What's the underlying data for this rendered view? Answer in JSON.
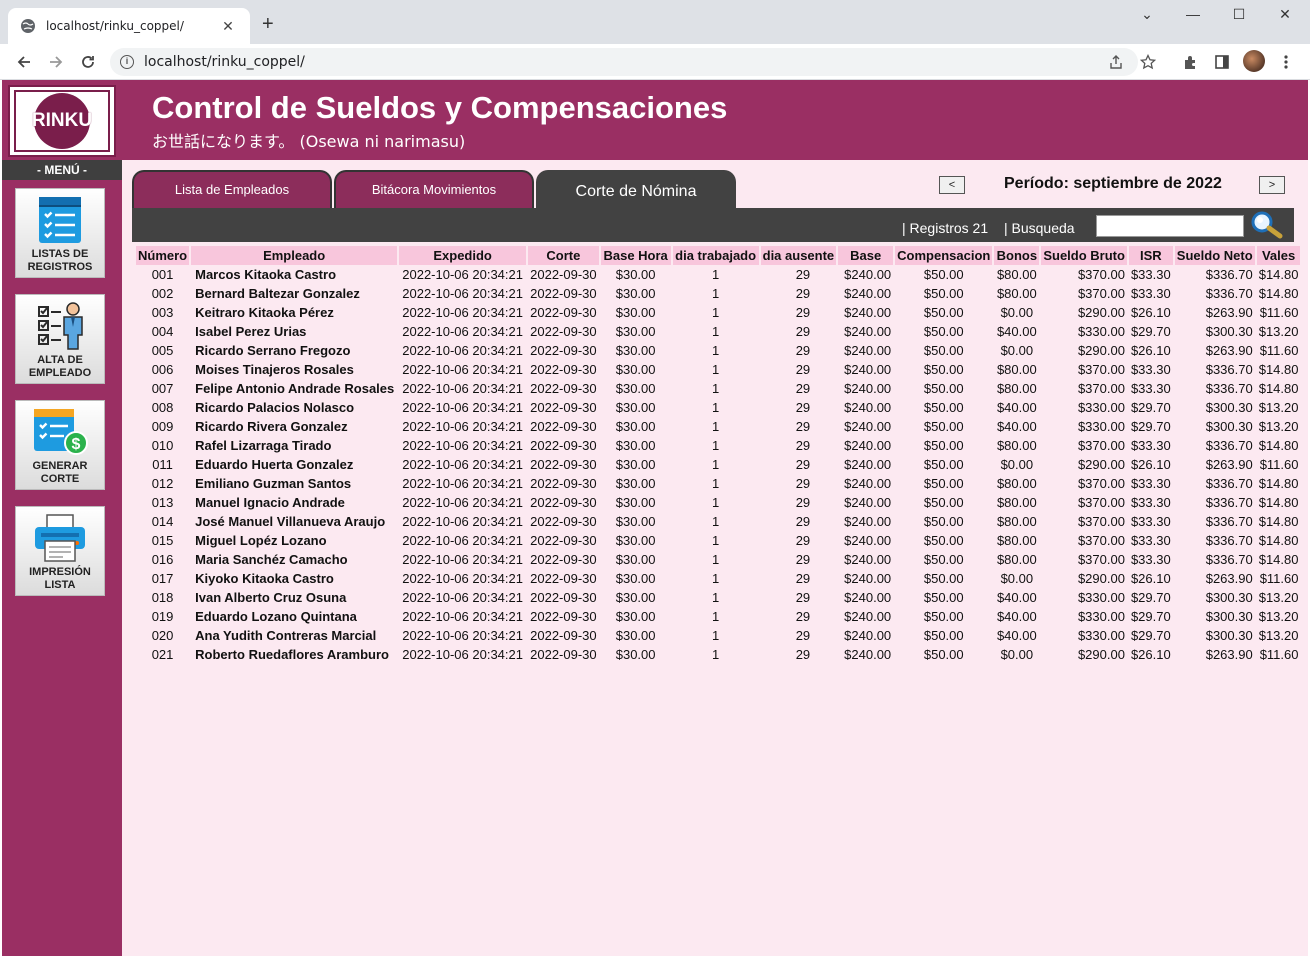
{
  "browser": {
    "tab_title": "localhost/rinku_coppel/",
    "url": "localhost/rinku_coppel/"
  },
  "app": {
    "logo_text": "RINKU",
    "title": "Control de Sueldos y Compensaciones",
    "subtitle": "お世話になります。 (Osewa ni narimasu)"
  },
  "sidebar": {
    "menu_title": "- MENÚ -",
    "items": [
      {
        "label": "LISTAS DE REGISTROS",
        "icon": "list-icon"
      },
      {
        "label": "ALTA DE EMPLEADO",
        "icon": "employee-checklist-icon"
      },
      {
        "label": "GENERAR CORTE",
        "icon": "payroll-dollar-icon"
      },
      {
        "label": "IMPRESIÓN LISTA",
        "icon": "printer-icon"
      }
    ]
  },
  "tabs": [
    {
      "label": "Lista de Empleados",
      "active": false
    },
    {
      "label": "Bitácora Movimientos",
      "active": false
    },
    {
      "label": "Corte de Nómina",
      "active": true
    }
  ],
  "period": {
    "prev": "<",
    "label": "Período: septiembre de 2022",
    "next": ">"
  },
  "filter": {
    "records": "|  Registros 21",
    "search_label": "|   Busqueda",
    "search_value": ""
  },
  "colors": {
    "brand": "#9a2f63",
    "header_cell": "#f8c6dc",
    "background": "#fce9f1",
    "bar": "#424242"
  },
  "table": {
    "headers": [
      "Número",
      "Empleado",
      "Expedido",
      "Corte",
      "Base Hora",
      "dia trabajado",
      "dia ausente",
      "Base",
      "Compensacion",
      "Bonos",
      "Sueldo Bruto",
      "ISR",
      "Sueldo Neto",
      "Vales"
    ],
    "rows": [
      [
        "001",
        "Marcos Kitaoka Castro",
        "2022-10-06 20:34:21",
        "2022-09-30",
        "$30.00",
        "1",
        "29",
        "$240.00",
        "$50.00",
        "$80.00",
        "$370.00",
        "$33.30",
        "$336.70",
        "$14.80"
      ],
      [
        "002",
        "Bernard Baltezar Gonzalez",
        "2022-10-06 20:34:21",
        "2022-09-30",
        "$30.00",
        "1",
        "29",
        "$240.00",
        "$50.00",
        "$80.00",
        "$370.00",
        "$33.30",
        "$336.70",
        "$14.80"
      ],
      [
        "003",
        "Keitraro Kitaoka Pérez",
        "2022-10-06 20:34:21",
        "2022-09-30",
        "$30.00",
        "1",
        "29",
        "$240.00",
        "$50.00",
        "$0.00",
        "$290.00",
        "$26.10",
        "$263.90",
        "$11.60"
      ],
      [
        "004",
        "Isabel Perez Urias",
        "2022-10-06 20:34:21",
        "2022-09-30",
        "$30.00",
        "1",
        "29",
        "$240.00",
        "$50.00",
        "$40.00",
        "$330.00",
        "$29.70",
        "$300.30",
        "$13.20"
      ],
      [
        "005",
        "Ricardo Serrano Fregozo",
        "2022-10-06 20:34:21",
        "2022-09-30",
        "$30.00",
        "1",
        "29",
        "$240.00",
        "$50.00",
        "$0.00",
        "$290.00",
        "$26.10",
        "$263.90",
        "$11.60"
      ],
      [
        "006",
        "Moises Tinajeros Rosales",
        "2022-10-06 20:34:21",
        "2022-09-30",
        "$30.00",
        "1",
        "29",
        "$240.00",
        "$50.00",
        "$80.00",
        "$370.00",
        "$33.30",
        "$336.70",
        "$14.80"
      ],
      [
        "007",
        "Felipe Antonio Andrade Rosales",
        "2022-10-06 20:34:21",
        "2022-09-30",
        "$30.00",
        "1",
        "29",
        "$240.00",
        "$50.00",
        "$80.00",
        "$370.00",
        "$33.30",
        "$336.70",
        "$14.80"
      ],
      [
        "008",
        "Ricardo Palacios Nolasco",
        "2022-10-06 20:34:21",
        "2022-09-30",
        "$30.00",
        "1",
        "29",
        "$240.00",
        "$50.00",
        "$40.00",
        "$330.00",
        "$29.70",
        "$300.30",
        "$13.20"
      ],
      [
        "009",
        "Ricardo Rivera Gonzalez",
        "2022-10-06 20:34:21",
        "2022-09-30",
        "$30.00",
        "1",
        "29",
        "$240.00",
        "$50.00",
        "$40.00",
        "$330.00",
        "$29.70",
        "$300.30",
        "$13.20"
      ],
      [
        "010",
        "Rafel Lizarraga Tirado",
        "2022-10-06 20:34:21",
        "2022-09-30",
        "$30.00",
        "1",
        "29",
        "$240.00",
        "$50.00",
        "$80.00",
        "$370.00",
        "$33.30",
        "$336.70",
        "$14.80"
      ],
      [
        "011",
        "Eduardo Huerta Gonzalez",
        "2022-10-06 20:34:21",
        "2022-09-30",
        "$30.00",
        "1",
        "29",
        "$240.00",
        "$50.00",
        "$0.00",
        "$290.00",
        "$26.10",
        "$263.90",
        "$11.60"
      ],
      [
        "012",
        "Emiliano Guzman Santos",
        "2022-10-06 20:34:21",
        "2022-09-30",
        "$30.00",
        "1",
        "29",
        "$240.00",
        "$50.00",
        "$80.00",
        "$370.00",
        "$33.30",
        "$336.70",
        "$14.80"
      ],
      [
        "013",
        "Manuel Ignacio Andrade",
        "2022-10-06 20:34:21",
        "2022-09-30",
        "$30.00",
        "1",
        "29",
        "$240.00",
        "$50.00",
        "$80.00",
        "$370.00",
        "$33.30",
        "$336.70",
        "$14.80"
      ],
      [
        "014",
        "José Manuel Villanueva Araujo",
        "2022-10-06 20:34:21",
        "2022-09-30",
        "$30.00",
        "1",
        "29",
        "$240.00",
        "$50.00",
        "$80.00",
        "$370.00",
        "$33.30",
        "$336.70",
        "$14.80"
      ],
      [
        "015",
        "Miguel Lopéz Lozano",
        "2022-10-06 20:34:21",
        "2022-09-30",
        "$30.00",
        "1",
        "29",
        "$240.00",
        "$50.00",
        "$80.00",
        "$370.00",
        "$33.30",
        "$336.70",
        "$14.80"
      ],
      [
        "016",
        "Maria Sanchéz Camacho",
        "2022-10-06 20:34:21",
        "2022-09-30",
        "$30.00",
        "1",
        "29",
        "$240.00",
        "$50.00",
        "$80.00",
        "$370.00",
        "$33.30",
        "$336.70",
        "$14.80"
      ],
      [
        "017",
        "Kiyoko Kitaoka Castro",
        "2022-10-06 20:34:21",
        "2022-09-30",
        "$30.00",
        "1",
        "29",
        "$240.00",
        "$50.00",
        "$0.00",
        "$290.00",
        "$26.10",
        "$263.90",
        "$11.60"
      ],
      [
        "018",
        "Ivan Alberto Cruz Osuna",
        "2022-10-06 20:34:21",
        "2022-09-30",
        "$30.00",
        "1",
        "29",
        "$240.00",
        "$50.00",
        "$40.00",
        "$330.00",
        "$29.70",
        "$300.30",
        "$13.20"
      ],
      [
        "019",
        "Eduardo Lozano Quintana",
        "2022-10-06 20:34:21",
        "2022-09-30",
        "$30.00",
        "1",
        "29",
        "$240.00",
        "$50.00",
        "$40.00",
        "$330.00",
        "$29.70",
        "$300.30",
        "$13.20"
      ],
      [
        "020",
        "Ana Yudith Contreras Marcial",
        "2022-10-06 20:34:21",
        "2022-09-30",
        "$30.00",
        "1",
        "29",
        "$240.00",
        "$50.00",
        "$40.00",
        "$330.00",
        "$29.70",
        "$300.30",
        "$13.20"
      ],
      [
        "021",
        "Roberto Ruedaflores Aramburo",
        "2022-10-06 20:34:21",
        "2022-09-30",
        "$30.00",
        "1",
        "29",
        "$240.00",
        "$50.00",
        "$0.00",
        "$290.00",
        "$26.10",
        "$263.90",
        "$11.60"
      ]
    ]
  }
}
